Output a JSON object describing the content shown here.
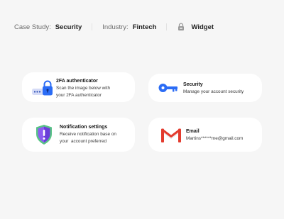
{
  "header": {
    "case_study_label": "Case Study:",
    "case_study_value": "Security",
    "industry_label": "Industry:",
    "industry_value": "Fintech",
    "widget_label": "Widget"
  },
  "cards": {
    "twofa": {
      "title": "2FA authenticator",
      "desc_line1": "Scan the image below with",
      "desc_line2": "your 2FA authenticator",
      "icon": "padlock-password-icon"
    },
    "security": {
      "title": "Security",
      "desc_line1": "Manage your account security",
      "icon": "key-icon"
    },
    "notifications": {
      "title": "Notification settings",
      "desc_line1": "Receive notification base on",
      "desc_line2": "your  account preferred",
      "icon": "shield-alert-icon"
    },
    "email": {
      "title": "Email",
      "desc_line1": "Martins******me@gmail.com",
      "icon": "gmail-icon"
    }
  },
  "colors": {
    "background": "#f6f6f6",
    "card": "#ffffff",
    "accent_blue": "#2b6cf5",
    "shield_purple": "#8c5cf0",
    "shield_green": "#59c486",
    "gmail_red": "#e33b2e"
  }
}
